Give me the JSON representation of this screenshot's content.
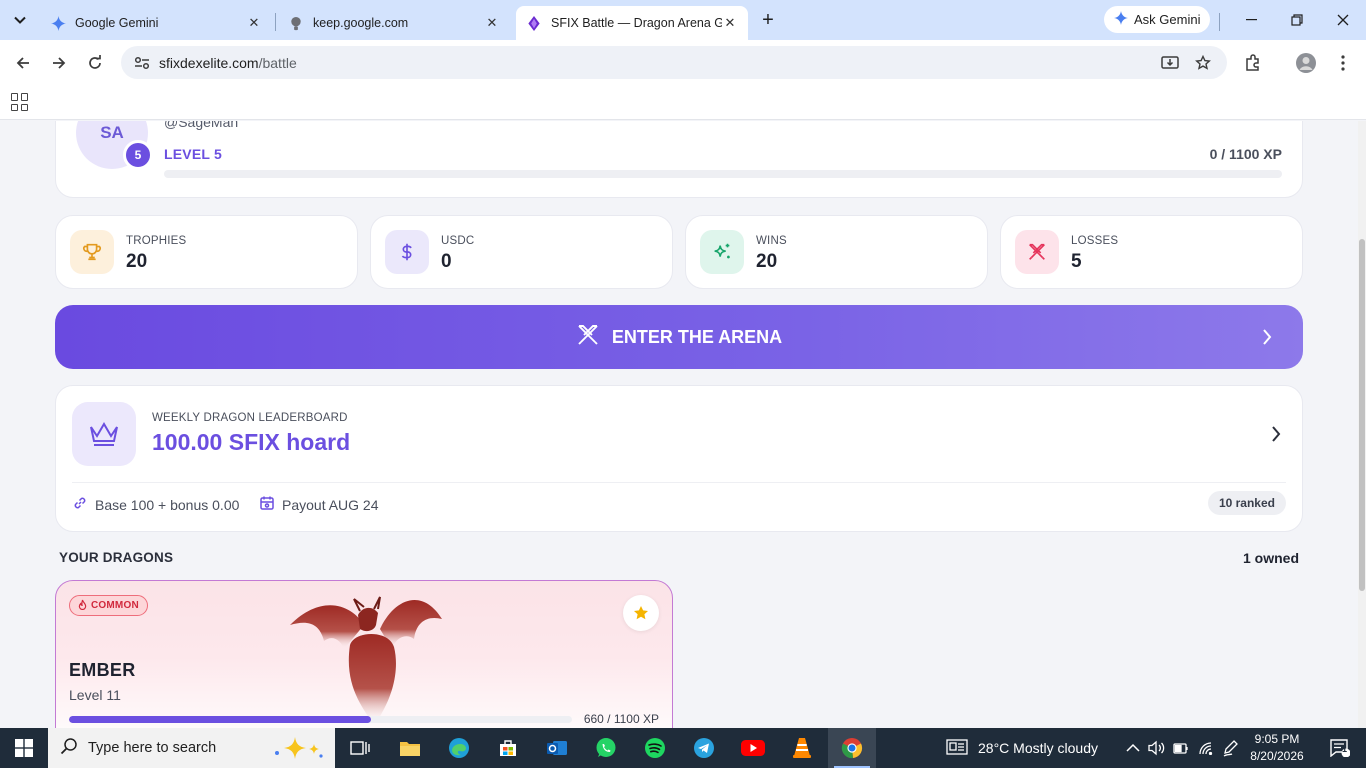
{
  "browser": {
    "tabs": [
      {
        "title": "Google Gemini",
        "icon": "gemini-icon"
      },
      {
        "title": "keep.google.com",
        "icon": "keep-icon"
      },
      {
        "title": "SFIX Battle — Dragon Arena Game",
        "icon": "sfix-icon",
        "active": true
      }
    ],
    "ask_gemini": "Ask Gemini",
    "url_host": "sfixdexelite.com",
    "url_path": "/battle"
  },
  "profile": {
    "initials": "SA",
    "handle": "@SageMan",
    "level_badge": "5",
    "level_label": "LEVEL 5",
    "xp_text": "0 / 1100 XP",
    "xp_progress": 0
  },
  "stats": [
    {
      "label": "TROPHIES",
      "value": "20",
      "icon": "trophy-icon"
    },
    {
      "label": "USDC",
      "value": "0",
      "icon": "dollar-icon"
    },
    {
      "label": "WINS",
      "value": "20",
      "icon": "sparkle-icon"
    },
    {
      "label": "LOSSES",
      "value": "5",
      "icon": "swords-icon"
    }
  ],
  "arena": {
    "label": "ENTER THE ARENA"
  },
  "leaderboard": {
    "kicker": "WEEKLY DRAGON LEADERBOARD",
    "amount": "100.00 SFIX hoard",
    "base": "Base 100 + bonus 0.00",
    "payout": "Payout AUG 24",
    "ranked": "10 ranked"
  },
  "dragons_section": {
    "title": "YOUR DRAGONS",
    "owned": "1 owned"
  },
  "dragon": {
    "rarity": "COMMON",
    "name": "EMBER",
    "level": "Level 11",
    "xp_text": "660 / 1100 XP",
    "xp_progress": 0.6
  },
  "taskbar": {
    "search_placeholder": "Type here to search",
    "weather": "28°C  Mostly cloudy",
    "time": "9:05 PM",
    "date": "8/20/2026",
    "notifications": "1"
  },
  "colors": {
    "accent": "#6b4fe0",
    "chrome_tabbar": "#d3e3fd",
    "taskbar": "#1f2c3a"
  }
}
